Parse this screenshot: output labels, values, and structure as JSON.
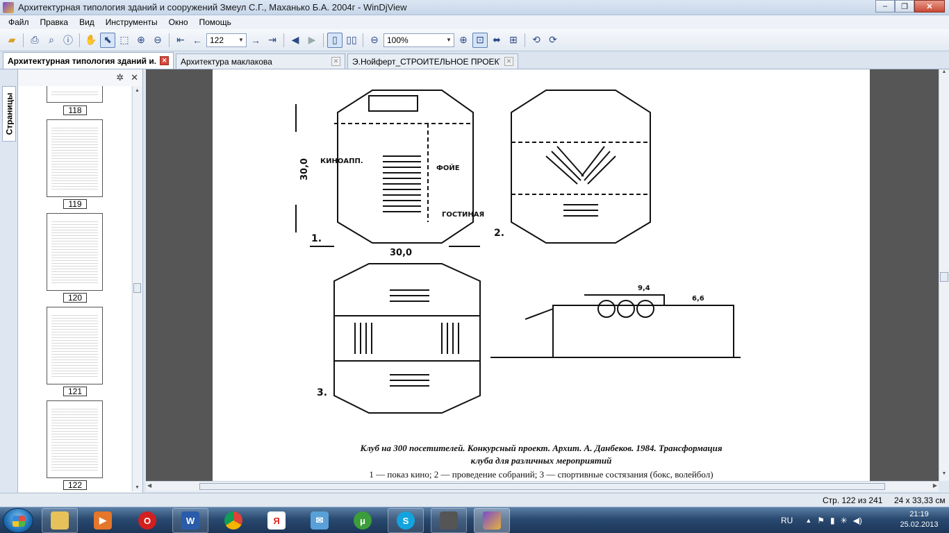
{
  "window": {
    "title": "Архитектурная типология зданий и сооружений Змеул С.Г., Маханько Б.А. 2004г - WinDjView",
    "controls": {
      "minimize": "–",
      "maximize": "❐",
      "close": "✕"
    }
  },
  "menu": [
    "Файл",
    "Правка",
    "Вид",
    "Инструменты",
    "Окно",
    "Помощь"
  ],
  "toolbar": {
    "page_value": "122",
    "zoom_value": "100%"
  },
  "tabs": [
    {
      "label": "Архитектурная типология зданий и...",
      "active": true
    },
    {
      "label": "Архитектура маклакова",
      "active": false
    },
    {
      "label": "Э.Нойферт_СТРОИТЕЛЬНОЕ ПРОЕКТИРО...",
      "active": false
    }
  ],
  "sidebar": {
    "tab_label": "Страницы",
    "thumbnails": [
      "118",
      "119",
      "120",
      "121",
      "122"
    ]
  },
  "document": {
    "caption_line1": "Клуб на 300 посетителей. Конкурсный проект. Архит. А. Данбеков. 1984. Трансформация",
    "caption_line2": "клуба для различных мероприятий",
    "caption_line3": "1 — показ кино; 2 — проведение собраний; 3 — спортивные состязания (бокс, волейбол)",
    "drawing_labels": {
      "plan1_number": "1.",
      "plan2_number": "2.",
      "plan3_number": "3.",
      "dim_vertical": "30,0",
      "dim_horizontal": "30,0",
      "room_foyer": "ФОЙЕ",
      "room_kinoapp": "КИНОАПП.",
      "room_gostinaya": "ГОСТИНАЯ",
      "mark_94": "9,4",
      "mark_66": "6,6"
    }
  },
  "status": {
    "page_info": "Стр. 122 из 241",
    "page_size": "24 x 33,33 см"
  },
  "taskbar": {
    "lang": "RU",
    "time": "21:19",
    "date": "25.02.2013"
  }
}
